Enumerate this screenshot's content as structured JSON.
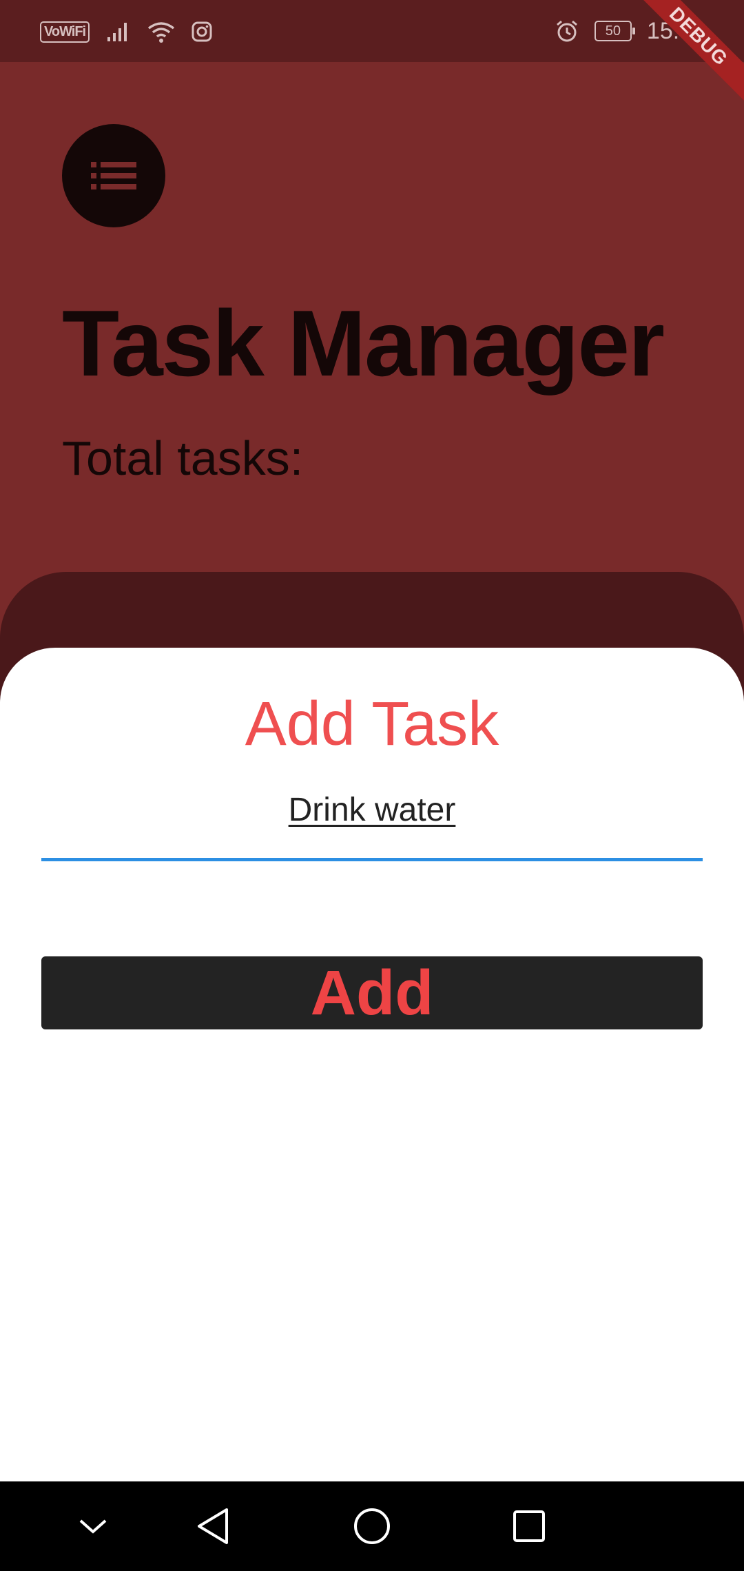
{
  "status_bar": {
    "vowifi_label": "VoWiFi",
    "battery_level": "50",
    "time": "15:33",
    "icons": [
      "signal-icon",
      "wifi-icon",
      "instagram-icon",
      "alarm-icon",
      "battery-icon"
    ]
  },
  "debug_banner": "DEBUG",
  "header": {
    "menu_icon": "list-icon",
    "title": "Task Manager",
    "subtitle": "Total tasks:"
  },
  "sheet": {
    "title": "Add Task",
    "input_value": "Drink water",
    "button_label": "Add"
  },
  "nav_bar": {
    "icons": [
      "collapse-icon",
      "back-icon",
      "home-icon",
      "recents-icon"
    ]
  },
  "colors": {
    "background": "#792a2a",
    "status_bar": "#5b1e1f",
    "dark_text": "#140707",
    "accent_red": "#ef4f50",
    "input_underline": "#2c8fe3",
    "button_bg": "#232323"
  }
}
